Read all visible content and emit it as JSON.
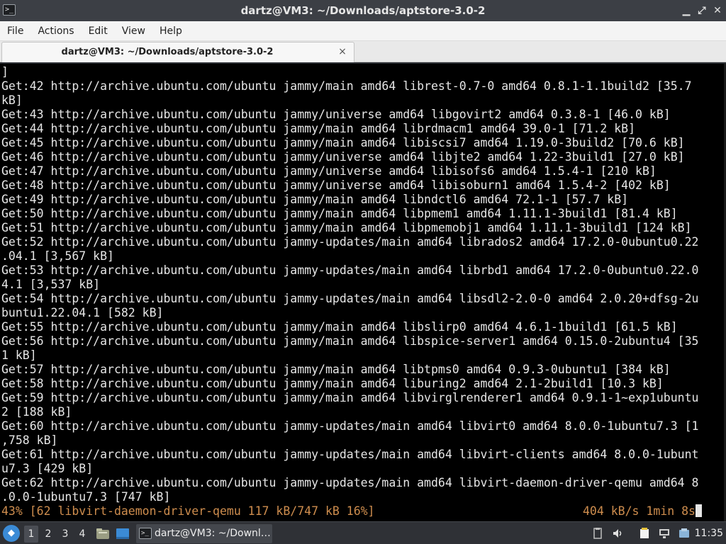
{
  "window": {
    "title": "dartz@VM3: ~/Downloads/aptstore-3.0-2",
    "controls": {
      "minimize": "▁",
      "maximize": "⤢",
      "close": "✕"
    }
  },
  "menubar": {
    "items": [
      "File",
      "Actions",
      "Edit",
      "View",
      "Help"
    ]
  },
  "tabs": [
    {
      "label": "dartz@VM3: ~/Downloads/aptstore-3.0-2",
      "close": "×"
    }
  ],
  "terminal": {
    "lines": [
      "]",
      "Get:42 http://archive.ubuntu.com/ubuntu jammy/main amd64 librest-0.7-0 amd64 0.8.1-1.1build2 [35.7",
      "kB]",
      "Get:43 http://archive.ubuntu.com/ubuntu jammy/universe amd64 libgovirt2 amd64 0.3.8-1 [46.0 kB]",
      "Get:44 http://archive.ubuntu.com/ubuntu jammy/main amd64 librdmacm1 amd64 39.0-1 [71.2 kB]",
      "Get:45 http://archive.ubuntu.com/ubuntu jammy/main amd64 libiscsi7 amd64 1.19.0-3build2 [70.6 kB]",
      "Get:46 http://archive.ubuntu.com/ubuntu jammy/universe amd64 libjte2 amd64 1.22-3build1 [27.0 kB]",
      "Get:47 http://archive.ubuntu.com/ubuntu jammy/universe amd64 libisofs6 amd64 1.5.4-1 [210 kB]",
      "Get:48 http://archive.ubuntu.com/ubuntu jammy/universe amd64 libisoburn1 amd64 1.5.4-2 [402 kB]",
      "Get:49 http://archive.ubuntu.com/ubuntu jammy/main amd64 libndctl6 amd64 72.1-1 [57.7 kB]",
      "Get:50 http://archive.ubuntu.com/ubuntu jammy/main amd64 libpmem1 amd64 1.11.1-3build1 [81.4 kB]",
      "Get:51 http://archive.ubuntu.com/ubuntu jammy/main amd64 libpmemobj1 amd64 1.11.1-3build1 [124 kB]",
      "Get:52 http://archive.ubuntu.com/ubuntu jammy-updates/main amd64 librados2 amd64 17.2.0-0ubuntu0.22",
      ".04.1 [3,567 kB]",
      "Get:53 http://archive.ubuntu.com/ubuntu jammy-updates/main amd64 librbd1 amd64 17.2.0-0ubuntu0.22.0",
      "4.1 [3,537 kB]",
      "Get:54 http://archive.ubuntu.com/ubuntu jammy-updates/main amd64 libsdl2-2.0-0 amd64 2.0.20+dfsg-2u",
      "buntu1.22.04.1 [582 kB]",
      "Get:55 http://archive.ubuntu.com/ubuntu jammy/main amd64 libslirp0 amd64 4.6.1-1build1 [61.5 kB]",
      "Get:56 http://archive.ubuntu.com/ubuntu jammy/main amd64 libspice-server1 amd64 0.15.0-2ubuntu4 [35",
      "1 kB]",
      "Get:57 http://archive.ubuntu.com/ubuntu jammy/main amd64 libtpms0 amd64 0.9.3-0ubuntu1 [384 kB]",
      "Get:58 http://archive.ubuntu.com/ubuntu jammy/main amd64 liburing2 amd64 2.1-2build1 [10.3 kB]",
      "Get:59 http://archive.ubuntu.com/ubuntu jammy/main amd64 libvirglrenderer1 amd64 0.9.1-1~exp1ubuntu",
      "2 [188 kB]",
      "Get:60 http://archive.ubuntu.com/ubuntu jammy-updates/main amd64 libvirt0 amd64 8.0.0-1ubuntu7.3 [1",
      ",758 kB]",
      "Get:61 http://archive.ubuntu.com/ubuntu jammy-updates/main amd64 libvirt-clients amd64 8.0.0-1ubunt",
      "u7.3 [429 kB]",
      "Get:62 http://archive.ubuntu.com/ubuntu jammy-updates/main amd64 libvirt-daemon-driver-qemu amd64 8",
      ".0.0-1ubuntu7.3 [747 kB]"
    ],
    "progress_left": "43% [62 libvirt-daemon-driver-qemu 117 kB/747 kB 16%]",
    "progress_right": "404 kB/s 1min 8s",
    "progress_color": "#ce8d4e"
  },
  "taskbar": {
    "start_icon": "lxqt-start-icon",
    "workspaces": [
      "1",
      "2",
      "3",
      "4"
    ],
    "active_workspace": "1",
    "task_label": "dartz@VM3: ~/Downl…",
    "clock": "11:35"
  }
}
